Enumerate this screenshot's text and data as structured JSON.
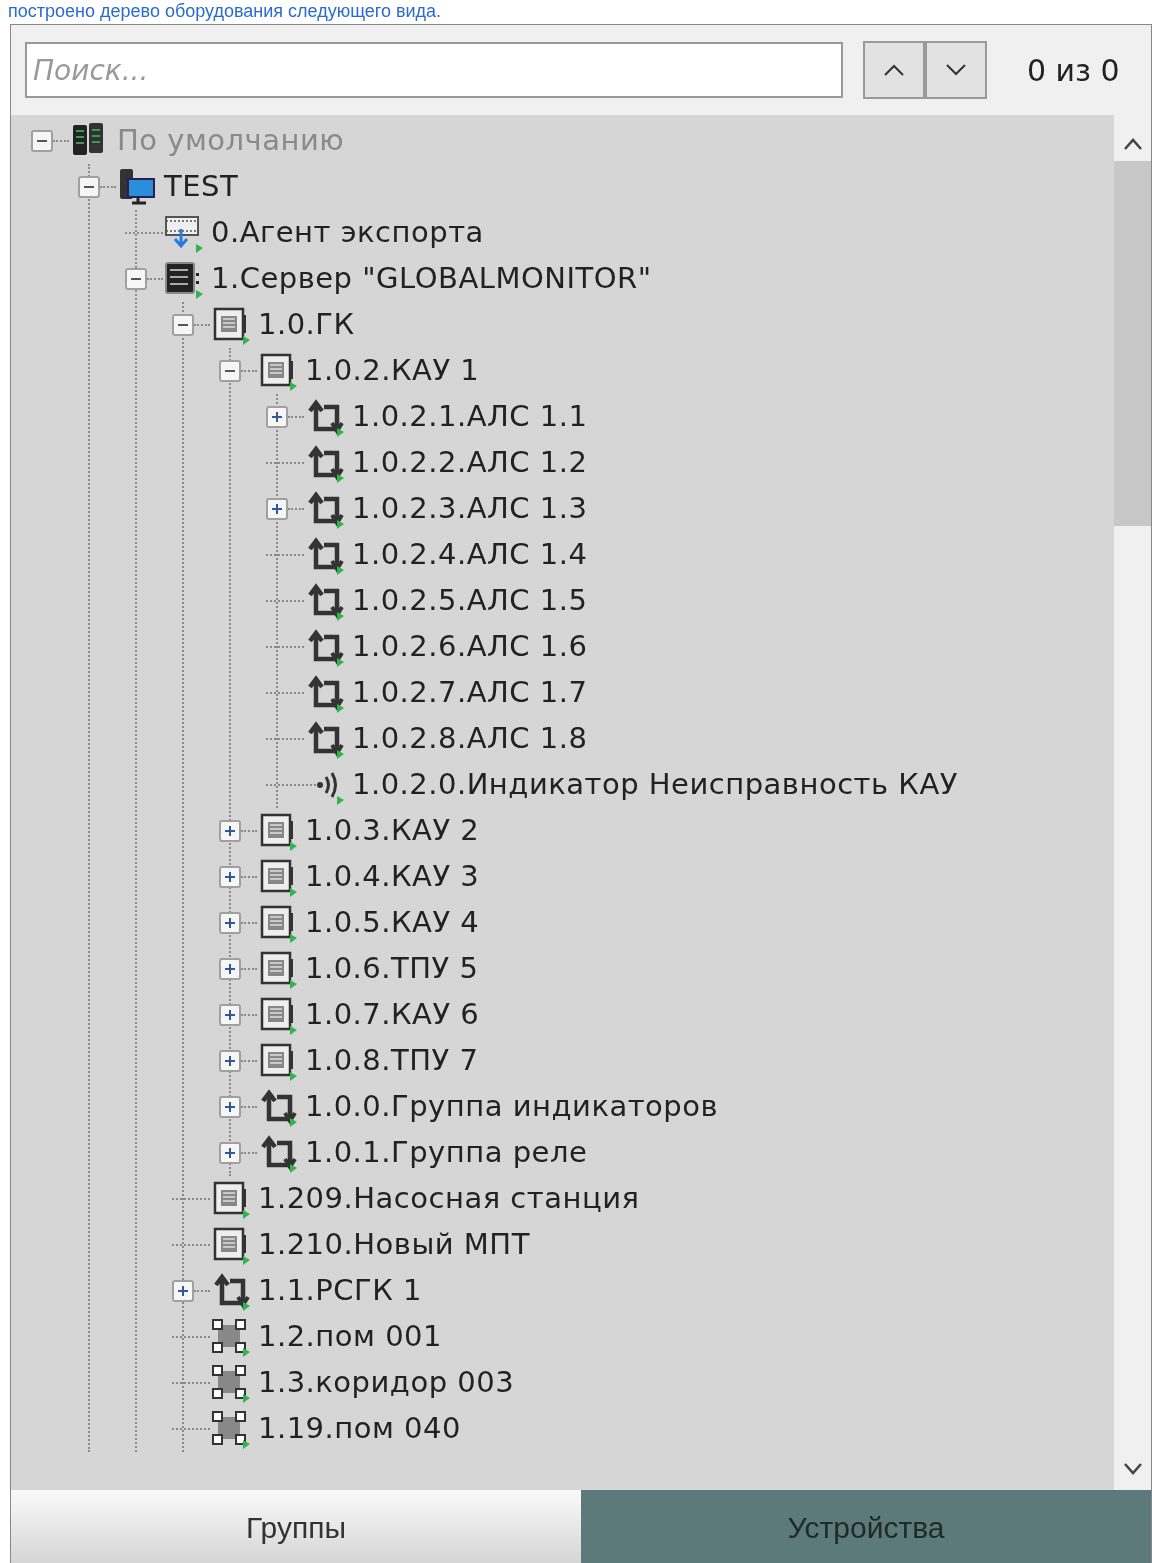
{
  "caption": "построено дерево оборудования следующего вида.",
  "search": {
    "placeholder": "Поиск...",
    "counter": "0 из 0"
  },
  "tree": [
    {
      "label": "По умолчанию",
      "kind": "root",
      "disabled": true,
      "expanded": true,
      "children": [
        {
          "label": "TEST",
          "kind": "computer",
          "disabled": false,
          "expanded": true,
          "children": [
            {
              "label": "0.Агент экспорта",
              "kind": "export",
              "disabled": false
            },
            {
              "label": "1.Сервер \"GLOBALMONITOR\"",
              "kind": "server",
              "disabled": false,
              "expanded": true,
              "children": [
                {
                  "label": "1.0.ГК",
                  "kind": "module",
                  "disabled": false,
                  "expanded": true,
                  "children": [
                    {
                      "label": "1.0.2.КАУ 1",
                      "kind": "module",
                      "disabled": false,
                      "expanded": true,
                      "children": [
                        {
                          "label": "1.0.2.1.АЛС 1.1",
                          "kind": "loop",
                          "disabled": false,
                          "expanded": false
                        },
                        {
                          "label": "1.0.2.2.АЛС 1.2",
                          "kind": "loop",
                          "disabled": false
                        },
                        {
                          "label": "1.0.2.3.АЛС 1.3",
                          "kind": "loop",
                          "disabled": false,
                          "expanded": false
                        },
                        {
                          "label": "1.0.2.4.АЛС 1.4",
                          "kind": "loop",
                          "disabled": false
                        },
                        {
                          "label": "1.0.2.5.АЛС 1.5",
                          "kind": "loop",
                          "disabled": false
                        },
                        {
                          "label": "1.0.2.6.АЛС 1.6",
                          "kind": "loop",
                          "disabled": false
                        },
                        {
                          "label": "1.0.2.7.АЛС 1.7",
                          "kind": "loop",
                          "disabled": false
                        },
                        {
                          "label": "1.0.2.8.АЛС 1.8",
                          "kind": "loop",
                          "disabled": false
                        },
                        {
                          "label": "1.0.2.0.Индикатор Неисправность КАУ",
                          "kind": "indicator",
                          "disabled": false
                        }
                      ]
                    },
                    {
                      "label": "1.0.3.КАУ 2",
                      "kind": "module",
                      "disabled": false,
                      "expanded": false
                    },
                    {
                      "label": "1.0.4.КАУ 3",
                      "kind": "module",
                      "disabled": false,
                      "expanded": false
                    },
                    {
                      "label": "1.0.5.КАУ 4",
                      "kind": "module",
                      "disabled": false,
                      "expanded": false
                    },
                    {
                      "label": "1.0.6.ТПУ 5",
                      "kind": "module",
                      "disabled": false,
                      "expanded": false
                    },
                    {
                      "label": "1.0.7.КАУ 6",
                      "kind": "module",
                      "disabled": false,
                      "expanded": false
                    },
                    {
                      "label": "1.0.8.ТПУ 7",
                      "kind": "module",
                      "disabled": false,
                      "expanded": false
                    },
                    {
                      "label": "1.0.0.Группа индикаторов",
                      "kind": "loop",
                      "disabled": false,
                      "expanded": false
                    },
                    {
                      "label": "1.0.1.Группа реле",
                      "kind": "loop",
                      "disabled": false,
                      "expanded": false
                    }
                  ]
                },
                {
                  "label": "1.209.Насосная станция",
                  "kind": "module",
                  "disabled": false
                },
                {
                  "label": "1.210.Новый МПТ",
                  "kind": "module",
                  "disabled": false
                },
                {
                  "label": "1.1.РСГК 1",
                  "kind": "loop",
                  "disabled": false,
                  "expanded": false
                },
                {
                  "label": "1.2.пом 001",
                  "kind": "zone",
                  "disabled": false
                },
                {
                  "label": "1.3.коридор 003",
                  "kind": "zone",
                  "disabled": false
                },
                {
                  "label": "1.19.пом 040",
                  "kind": "zone",
                  "disabled": false
                }
              ]
            }
          ]
        }
      ]
    }
  ],
  "tabs": [
    {
      "label": "Группы",
      "selected": false
    },
    {
      "label": "Устройства",
      "selected": true
    }
  ]
}
